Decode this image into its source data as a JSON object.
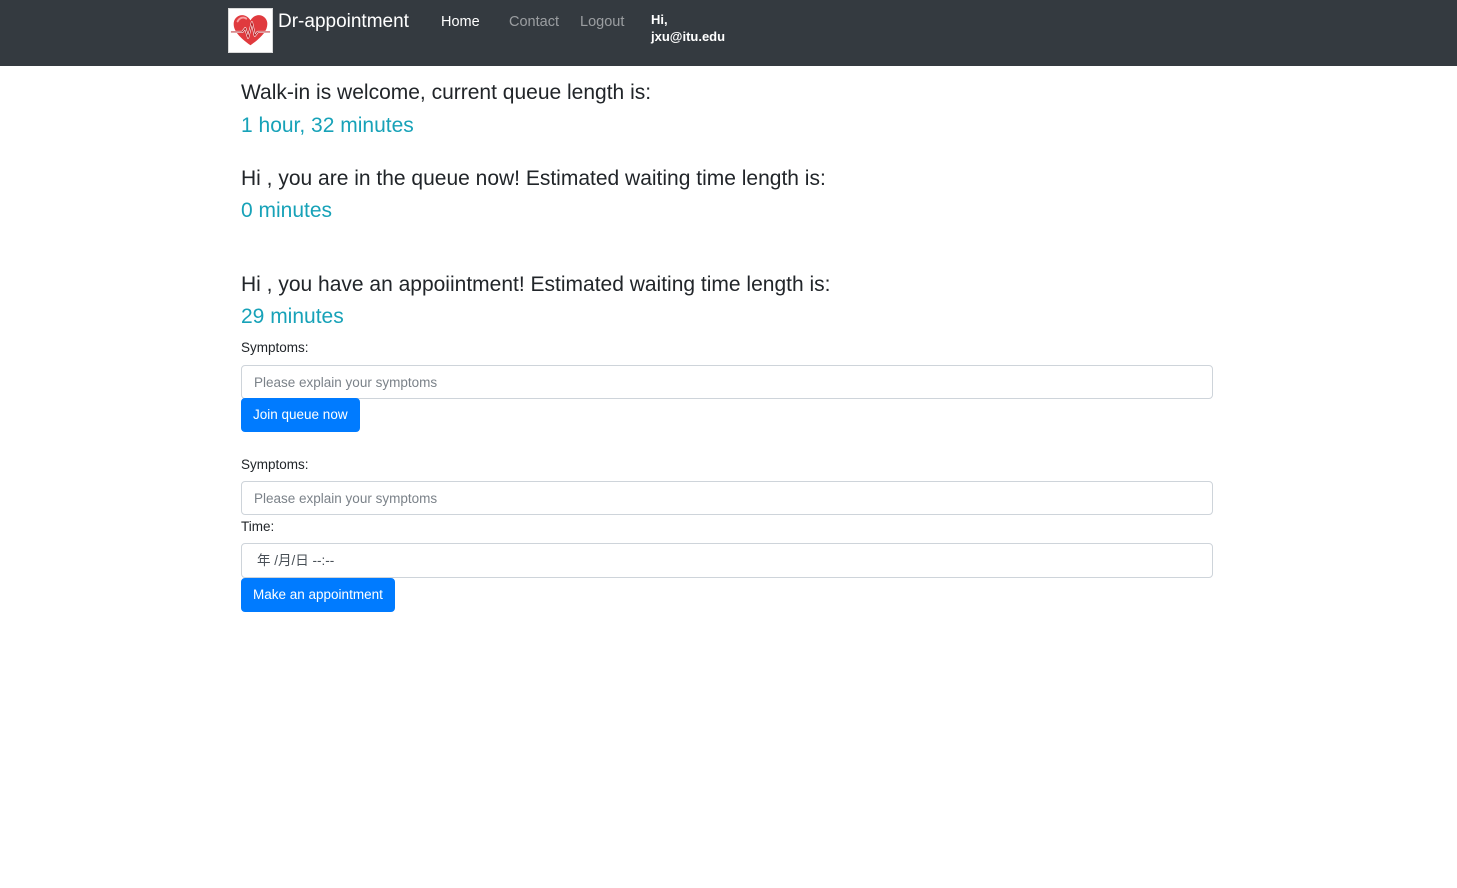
{
  "navbar": {
    "brand": "Dr-appointment",
    "links": [
      {
        "label": "Home",
        "active": true
      },
      {
        "label": "Contact",
        "active": false
      },
      {
        "label": "Logout",
        "active": false
      }
    ],
    "greeting_hi": "Hi,",
    "greeting_user": "jxu@itu.edu"
  },
  "queue": {
    "heading": "Walk-in is welcome, current queue length is:",
    "value": "1 hour, 32 minutes"
  },
  "in_queue": {
    "heading": "Hi , you are in the queue now! Estimated waiting time length is:",
    "value": "0 minutes"
  },
  "appointment": {
    "heading": "Hi , you have an appoiintment! Estimated waiting time length is:",
    "value": "29 minutes"
  },
  "join_form": {
    "symptoms_label": "Symptoms:",
    "symptoms_placeholder": "Please explain your symptoms",
    "submit_label": "Join queue now"
  },
  "appointment_form": {
    "symptoms_label": "Symptoms:",
    "symptoms_placeholder": "Please explain your symptoms",
    "time_label": "Time:",
    "time_value": "年 /月/日 --:--",
    "submit_label": "Make an appointment"
  },
  "colors": {
    "navbar_bg": "#343a40",
    "accent_value": "#17a2b8",
    "primary_button": "#007bff"
  },
  "icons": {
    "logo": "heart-pulse-icon"
  }
}
